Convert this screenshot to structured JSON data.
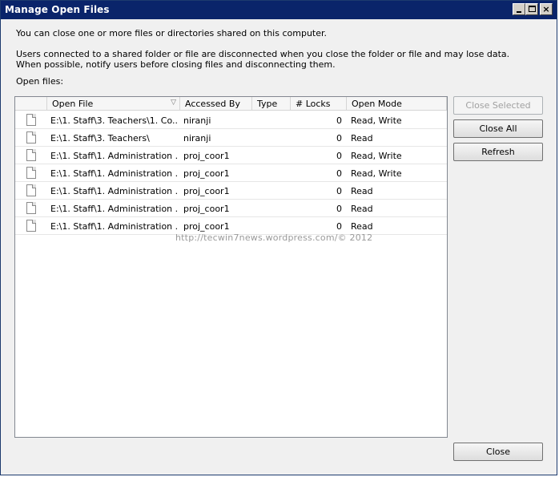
{
  "window": {
    "title": "Manage Open Files",
    "controls": {
      "minimize": "_",
      "maximize": "□",
      "close": "×"
    }
  },
  "intro": "You can close one or more files or directories shared on this computer.",
  "warning": "Users connected to a shared folder or file are disconnected when you close the folder or file and may lose data. When possible, notify users before closing files and disconnecting them.",
  "list_label": "Open files:",
  "columns": {
    "open_file": "Open File",
    "accessed_by": "Accessed By",
    "type": "Type",
    "locks": "# Locks",
    "open_mode": "Open Mode"
  },
  "rows": [
    {
      "file": "E:\\1. Staff\\3. Teachers\\1. Co...",
      "user": "niranji",
      "type": "",
      "locks": "0",
      "mode": "Read, Write"
    },
    {
      "file": "E:\\1. Staff\\3. Teachers\\",
      "user": "niranji",
      "type": "",
      "locks": "0",
      "mode": "Read"
    },
    {
      "file": "E:\\1. Staff\\1. Administration ...",
      "user": "proj_coor1",
      "type": "",
      "locks": "0",
      "mode": "Read, Write"
    },
    {
      "file": "E:\\1. Staff\\1. Administration ...",
      "user": "proj_coor1",
      "type": "",
      "locks": "0",
      "mode": "Read, Write"
    },
    {
      "file": "E:\\1. Staff\\1. Administration ...",
      "user": "proj_coor1",
      "type": "",
      "locks": "0",
      "mode": "Read"
    },
    {
      "file": "E:\\1. Staff\\1. Administration ...",
      "user": "proj_coor1",
      "type": "",
      "locks": "0",
      "mode": "Read"
    },
    {
      "file": "E:\\1. Staff\\1. Administration ...",
      "user": "proj_coor1",
      "type": "",
      "locks": "0",
      "mode": "Read"
    }
  ],
  "buttons": {
    "close_selected": "Close Selected",
    "close_all": "Close All",
    "refresh": "Refresh",
    "close": "Close"
  },
  "watermark": "http://tecwin7news.wordpress.com/© 2012",
  "icons": {
    "file": "document-icon",
    "sort": "sort-descending-icon"
  }
}
